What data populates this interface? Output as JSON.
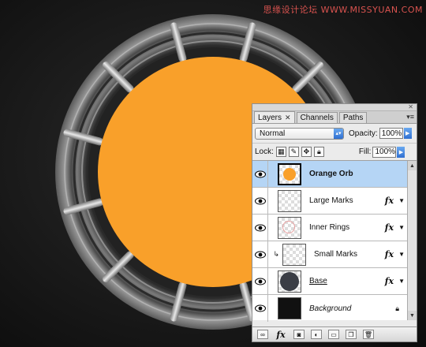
{
  "watermark": "思缘设计论坛 WWW.MISSYUAN.COM",
  "colors": {
    "orb": "#f9a02a",
    "ring_dark": "#3a3a3a",
    "ring_mid": "#8a8a8a",
    "selection": "#b5d5f5",
    "accent_blue": "#2f6fd1"
  },
  "panel": {
    "close_icon": "close-icon",
    "menu_icon": "panel-menu-icon",
    "tabs": [
      {
        "label": "Layers",
        "active": true
      },
      {
        "label": "Channels",
        "active": false
      },
      {
        "label": "Paths",
        "active": false
      }
    ],
    "blend_mode": "Normal",
    "opacity_label": "Opacity:",
    "opacity_value": "100%",
    "lock_label": "Lock:",
    "fill_label": "Fill:",
    "fill_value": "100%",
    "layers": [
      {
        "name": "Orange Orb",
        "selected": true,
        "fx": false,
        "thumb": "orange-circle"
      },
      {
        "name": "Large Marks",
        "selected": false,
        "fx": true,
        "thumb": "transparent"
      },
      {
        "name": "Inner Rings",
        "selected": false,
        "fx": true,
        "thumb": "transparent"
      },
      {
        "name": "Small Marks",
        "selected": false,
        "fx": true,
        "thumb": "transparent",
        "clipped": true
      },
      {
        "name": "Base",
        "selected": false,
        "fx": true,
        "thumb": "dark-circle"
      },
      {
        "name": "Background",
        "selected": false,
        "fx": false,
        "thumb": "black",
        "locked": true
      }
    ],
    "fx_label": "fx",
    "bottom_icons": [
      "link-icon",
      "fx-icon",
      "mask-icon",
      "adjustment-icon",
      "group-icon",
      "new-layer-icon",
      "trash-icon"
    ]
  }
}
